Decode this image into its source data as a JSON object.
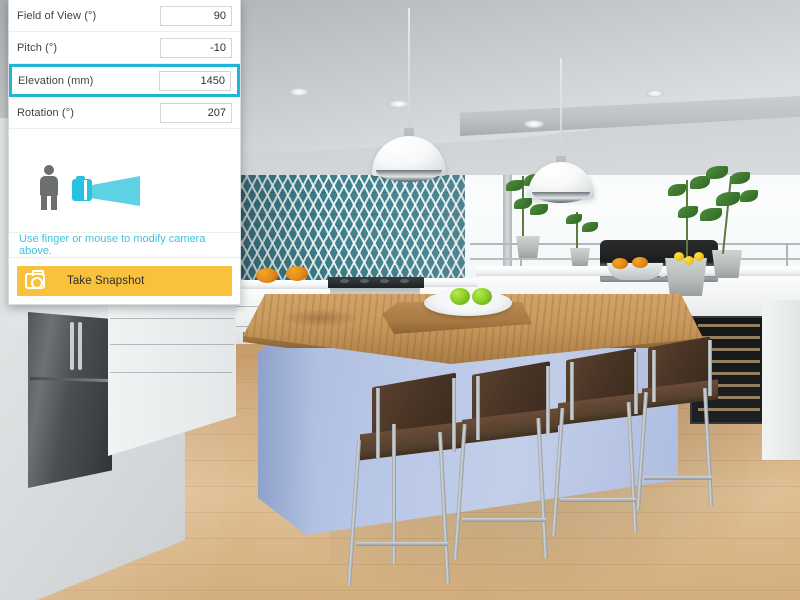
{
  "panel": {
    "fields": [
      {
        "name": "field-of-view",
        "label": "Field of View (°)",
        "value": "90",
        "highlighted": false
      },
      {
        "name": "pitch",
        "label": "Pitch (°)",
        "value": "-10",
        "highlighted": false
      },
      {
        "name": "elevation",
        "label": "Elevation (mm)",
        "value": "1450",
        "highlighted": true
      },
      {
        "name": "rotation",
        "label": "Rotation (°)",
        "value": "207",
        "highlighted": false
      }
    ],
    "camera_widget": {
      "person_icon": "person-icon",
      "camera_icon": "camera-view-cone-icon"
    },
    "hint": "Use finger or mouse to modify camera above.",
    "snapshot_button": {
      "label": "Take Snapshot",
      "icon": "camera-icon"
    }
  },
  "scene": {
    "name": "3d-kitchen-render",
    "description": "Modern kitchen with island, bar stools and pendant lights"
  },
  "colors": {
    "highlight_border": "#1fb6d4",
    "hint_text": "#3cc3dd",
    "snapshot_button_bg": "#f9c13c",
    "camera_icon": "#27c3df",
    "camera_cone": "#5ed1e4",
    "panel_bg": "#ffffff",
    "backsplash_teal": "#3d7f8c",
    "island_blue": "#b8c6e6",
    "wood_counter": "#c99a5e",
    "floor_wood": "#d8b184"
  }
}
